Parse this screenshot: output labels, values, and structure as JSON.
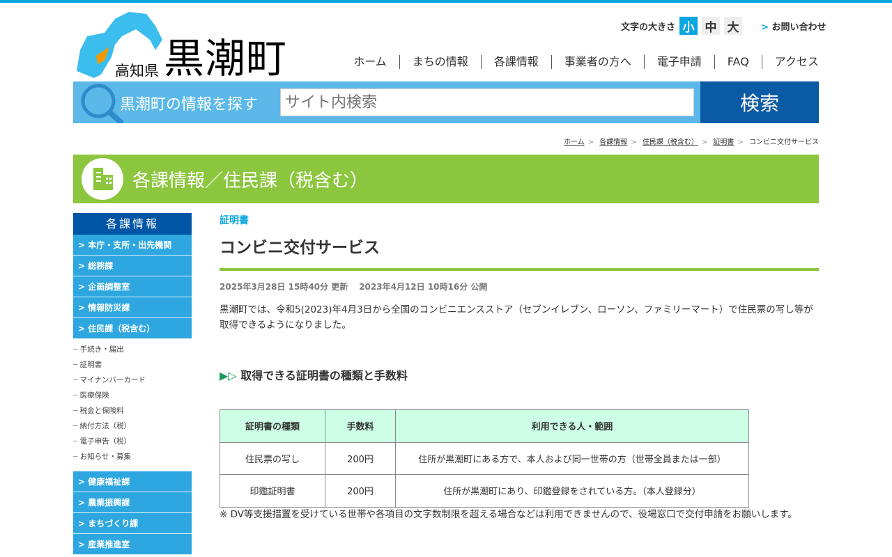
{
  "header": {
    "prefecture": "高知県",
    "town": "黒潮町",
    "font_size_label": "文字の大きさ",
    "font_sizes": [
      "小",
      "中",
      "大"
    ],
    "contact": "お問い合わせ"
  },
  "nav": [
    "ホーム",
    "まちの情報",
    "各課情報",
    "事業者の方へ",
    "電子申請",
    "FAQ",
    "アクセス"
  ],
  "search": {
    "label": "黒潮町の情報を探す",
    "placeholder": "サイト内検索",
    "button": "検索"
  },
  "breadcrumb": [
    "ホーム",
    "各課情報",
    "住民課（税含む）",
    "証明書",
    "コンビニ交付サービス"
  ],
  "banner": "各課情報／住民課（税含む）",
  "sidebar": {
    "title": "各課情報",
    "items": [
      "本庁・支所・出先機関",
      "総務課",
      "企画調整室",
      "情報防災課",
      "住民課（税含む）"
    ],
    "sub": [
      "手続き・届出",
      "証明書",
      "マイナンバーカード",
      "医療保険",
      "税金と保険料",
      "納付方法（税）",
      "電子申告（税）",
      "お知らせ・募集"
    ],
    "items2": [
      "健康福祉課",
      "農業振興課",
      "まちづくり課",
      "産業推進室"
    ]
  },
  "main": {
    "category": "証明書",
    "title": "コンビニ交付サービス",
    "updated": "2025年3月28日 15時40分 更新",
    "published": "2023年4月12日 10時16分 公開",
    "intro": "黒潮町では、令和5(2023)年4月3日から全国のコンビニエンスストア（セブンイレブン、ローソン、ファミリーマート）で住民票の写し等が取得できるようになりました。",
    "section": "取得できる証明書の種類と手数料",
    "table": {
      "headers": [
        "証明書の種類",
        "手数料",
        "利用できる人・範囲"
      ],
      "rows": [
        [
          "住民票の写し",
          "200円",
          "住所が黒潮町にある方で、本人および同一世帯の方（世帯全員または一部）"
        ],
        [
          "印鑑証明書",
          "200円",
          "住所が黒潮町にあり、印鑑登録をされている方。（本人登録分）"
        ]
      ]
    },
    "note": "※ DV等支援措置を受けている世帯や各項目の文字数制限を超える場合などは利用できませんので、役場窓口で交付申請をお願いします。"
  }
}
